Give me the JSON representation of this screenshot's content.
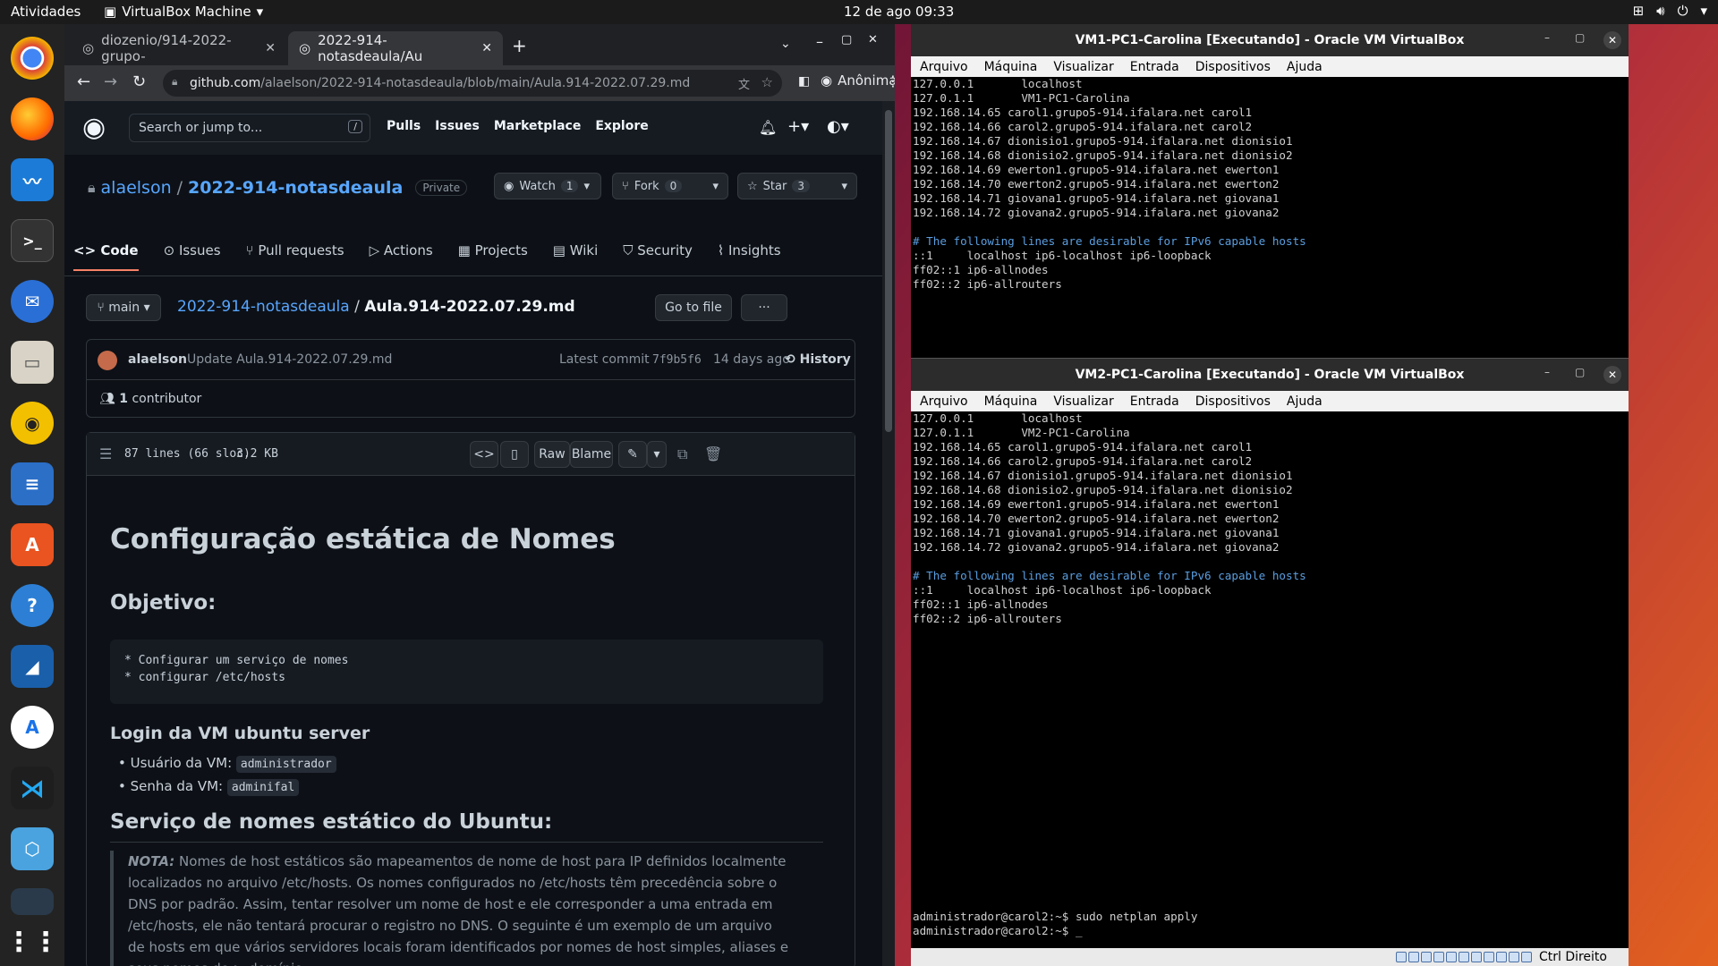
{
  "topbar": {
    "activities": "Atividades",
    "app_name": "VirtualBox Machine",
    "clock": "12 de ago  09:33"
  },
  "browser": {
    "tabs": [
      {
        "title": "diozenio/914-2022-grupo-",
        "active": false
      },
      {
        "title": "2022-914-notasdeaula/Au",
        "active": true
      }
    ],
    "url_host": "github.com",
    "url_path": "/alaelson/2022-914-notasdeaula/blob/main/Aula.914-2022.07.29.md",
    "profile": "Anônima"
  },
  "github": {
    "search_placeholder": "Search or jump to...",
    "search_key": "/",
    "nav": [
      "Pulls",
      "Issues",
      "Marketplace",
      "Explore"
    ],
    "owner": "alaelson",
    "sep": "/",
    "repo": "2022-914-notasdeaula",
    "visibility": "Private",
    "watch": {
      "label": "Watch",
      "count": "1"
    },
    "fork": {
      "label": "Fork",
      "count": "0"
    },
    "star": {
      "label": "Star",
      "count": "3"
    },
    "tabs": [
      "Code",
      "Issues",
      "Pull requests",
      "Actions",
      "Projects",
      "Wiki",
      "Security",
      "Insights"
    ],
    "branch": "main",
    "path_repo": "2022-914-notasdeaula",
    "path_sep": "/",
    "path_file": "Aula.914-2022.07.29.md",
    "goto_file": "Go to file",
    "more": "···",
    "commit_author": "alaelson",
    "commit_msg": "Update Aula.914-2022.07.29.md",
    "commit_prefix": "Latest commit",
    "commit_sha": "7f9b5f6",
    "commit_age": "14 days ago",
    "history": "History",
    "contributors": "1",
    "contributors_label": "contributor",
    "lines": "87 lines (66 sloc)",
    "size": "3.2 KB",
    "raw": "Raw",
    "blame": "Blame"
  },
  "markdown": {
    "h1": "Configuração estática de Nomes",
    "objective_heading": "Objetivo:",
    "objective_code": "* Configurar um serviço de nomes\n* configurar /etc/hosts",
    "login_heading": "Login da VM ubuntu server",
    "user_label": "Usuário da VM:",
    "user_value": "administrador",
    "pass_label": "Senha da VM:",
    "pass_value": "adminifal",
    "service_heading": "Serviço de nomes estático do Ubuntu:",
    "note_label": "NOTA:",
    "note_text": "Nomes de host estáticos são mapeamentos de nome de host para IP definidos localmente localizados no arquivo /etc/hosts. Os nomes configurados no /etc/hosts têm precedência sobre o DNS por padrão. Assim, tentar resolver um nome de host e ele corresponder a uma entrada em /etc/hosts, ele não tentará procurar o registro no DNS. O seguinte é um exemplo de um arquivo de hosts em que vários servidores locais foram identificados por nomes de host simples, aliases e seus nomes de > domínio"
  },
  "vm1": {
    "title": "VM1-PC1-Carolina [Executando] - Oracle VM VirtualBox",
    "menu": [
      "Arquivo",
      "Máquina",
      "Visualizar",
      "Entrada",
      "Dispositivos",
      "Ajuda"
    ],
    "hosts": "127.0.0.1       localhost\n127.0.1.1       VM1-PC1-Carolina\n192.168.14.65 carol1.grupo5-914.ifalara.net carol1\n192.168.14.66 carol2.grupo5-914.ifalara.net carol2\n192.168.14.67 dionisio1.grupo5-914.ifalara.net dionisio1\n192.168.14.68 dionisio2.grupo5-914.ifalara.net dionisio2\n192.168.14.69 ewerton1.grupo5-914.ifalara.net ewerton1\n192.168.14.70 ewerton2.grupo5-914.ifalara.net ewerton2\n192.168.14.71 giovana1.grupo5-914.ifalara.net giovana1\n192.168.14.72 giovana2.grupo5-914.ifalara.net giovana2",
    "comment": "# The following lines are desirable for IPv6 capable hosts",
    "ipv6": "::1     localhost ip6-localhost ip6-loopback\nff02::1 ip6-allnodes\nff02::2 ip6-allrouters"
  },
  "vm2": {
    "title": "VM2-PC1-Carolina [Executando] - Oracle VM VirtualBox",
    "menu": [
      "Arquivo",
      "Máquina",
      "Visualizar",
      "Entrada",
      "Dispositivos",
      "Ajuda"
    ],
    "hosts": "127.0.0.1       localhost\n127.0.1.1       VM2-PC1-Carolina\n192.168.14.65 carol1.grupo5-914.ifalara.net carol1\n192.168.14.66 carol2.grupo5-914.ifalara.net carol2\n192.168.14.67 dionisio1.grupo5-914.ifalara.net dionisio1\n192.168.14.68 dionisio2.grupo5-914.ifalara.net dionisio2\n192.168.14.69 ewerton1.grupo5-914.ifalara.net ewerton1\n192.168.14.70 ewerton2.grupo5-914.ifalara.net ewerton2\n192.168.14.71 giovana1.grupo5-914.ifalara.net giovana1\n192.168.14.72 giovana2.grupo5-914.ifalara.net giovana2",
    "comment": "# The following lines are desirable for IPv6 capable hosts",
    "ipv6": "::1     localhost ip6-localhost ip6-loopback\nff02::1 ip6-allnodes\nff02::2 ip6-allrouters",
    "prompt1": "administrador@carol2:~$ sudo netplan apply",
    "prompt2": "administrador@carol2:~$ _",
    "host_key": "Ctrl Direito"
  },
  "dock": [
    "chrome-icon",
    "firefox-icon",
    "monitor-icon",
    "terminal-icon",
    "mail-icon",
    "files-icon",
    "music-icon",
    "writer-icon",
    "appstore-icon",
    "help-icon",
    "wireshark-icon",
    "android-icon",
    "vscode-icon",
    "virtualbox-icon",
    "grid-icon"
  ]
}
